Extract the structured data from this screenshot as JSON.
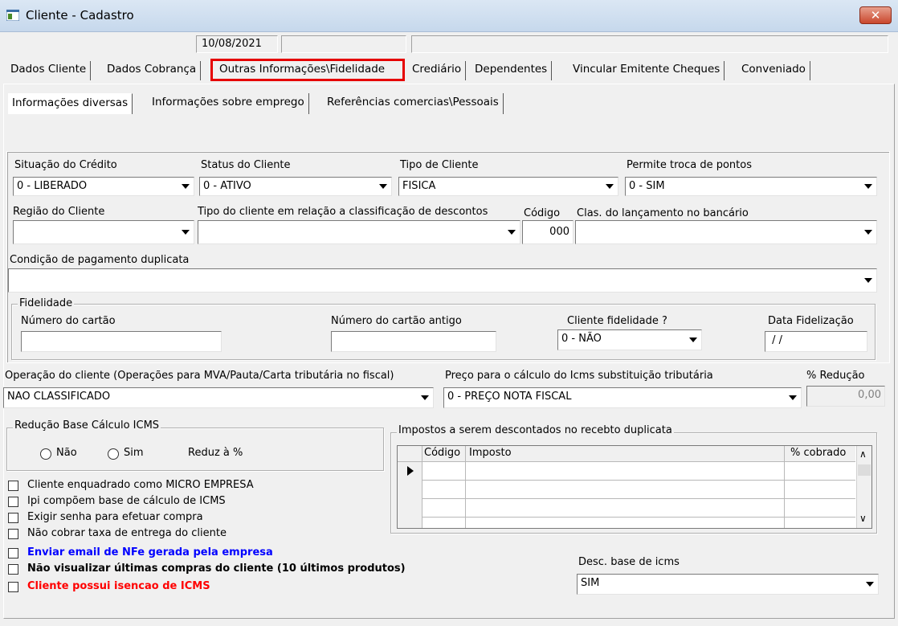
{
  "window": {
    "title": "Cliente - Cadastro",
    "close": "✕"
  },
  "status_bar": {
    "date": "10/08/2021",
    "field2": "",
    "field3": ""
  },
  "tabs": [
    {
      "label": "Dados Cliente"
    },
    {
      "label": "Dados Cobrança"
    },
    {
      "label": "Outras Informações\\Fidelidade"
    },
    {
      "label": "Crediário"
    },
    {
      "label": "Dependentes"
    },
    {
      "label": "Vincular Emitente Cheques"
    },
    {
      "label": "Conveniado"
    }
  ],
  "subtabs": [
    {
      "label": "Informações diversas"
    },
    {
      "label": "Informações sobre emprego"
    },
    {
      "label": "Referências comercias\\Pessoais"
    }
  ],
  "form": {
    "situacao_credito": {
      "label": "Situação do Crédito",
      "value": "0 - LIBERADO"
    },
    "status_cliente": {
      "label": "Status do Cliente",
      "value": "0 - ATIVO"
    },
    "tipo_cliente": {
      "label": "Tipo de Cliente",
      "value": "FISICA"
    },
    "permite_troca": {
      "label": "Permite troca de pontos",
      "value": "0 - SIM"
    },
    "regiao": {
      "label": "Região do Cliente",
      "value": ""
    },
    "tipo_classificacao": {
      "label": "Tipo do cliente em relação a classificação de descontos",
      "value": ""
    },
    "codigo": {
      "label": "Código",
      "value": "000"
    },
    "clas_lancamento": {
      "label": "Clas. do lançamento no bancário",
      "value": ""
    },
    "condicao_pagamento": {
      "label": "Condição de pagamento duplicata",
      "value": ""
    }
  },
  "fidelidade": {
    "legend": "Fidelidade",
    "numero_cartao": {
      "label": "Número do cartão",
      "value": ""
    },
    "numero_cartao_antigo": {
      "label": "Número do cartão antigo",
      "value": ""
    },
    "cliente_fidelidade": {
      "label": "Cliente fidelidade ?",
      "value": "0 - NÃO"
    },
    "data_fidelizacao": {
      "label": "Data Fidelização",
      "value": " / /"
    }
  },
  "operacao": {
    "label": "Operação do cliente (Operações para MVA/Pauta/Carta tributária no fiscal)",
    "value": "NAO CLASSIFICADO"
  },
  "preco_icms": {
    "label": "Preço para o cálculo do Icms substituição tributária",
    "value": "0 - PREÇO NOTA FISCAL"
  },
  "reducao": {
    "label": "% Redução",
    "value": "0,00"
  },
  "reducao_base": {
    "legend": "Redução Base Cálculo ICMS",
    "nao": "Não",
    "sim": "Sim",
    "reduz": "Reduz à %"
  },
  "impostos": {
    "legend": "Impostos a serem descontados no recebto duplicata",
    "columns": [
      "Código",
      "Imposto",
      "% cobrado"
    ],
    "scroll_up": "∧",
    "scroll_down": "∨"
  },
  "checkboxes": [
    {
      "label": "Cliente enquadrado como MICRO EMPRESA",
      "color": "#000000"
    },
    {
      "label": "Ipi compõem base de cálculo de ICMS",
      "color": "#000000"
    },
    {
      "label": "Exigir senha para efetuar compra",
      "color": "#000000"
    },
    {
      "label": "Não cobrar taxa de entrega do cliente",
      "color": "#000000"
    },
    {
      "label": "Enviar email de NFe gerada pela empresa",
      "color": "#0000ff"
    },
    {
      "label": "Não visualizar últimas compras do cliente (10 últimos produtos)",
      "color": "#000000"
    },
    {
      "label": "Cliente possui isencao de ICMS",
      "color": "#ff0000"
    }
  ],
  "desc_base_icms": {
    "label": "Desc. base de icms",
    "value": "SIM"
  }
}
